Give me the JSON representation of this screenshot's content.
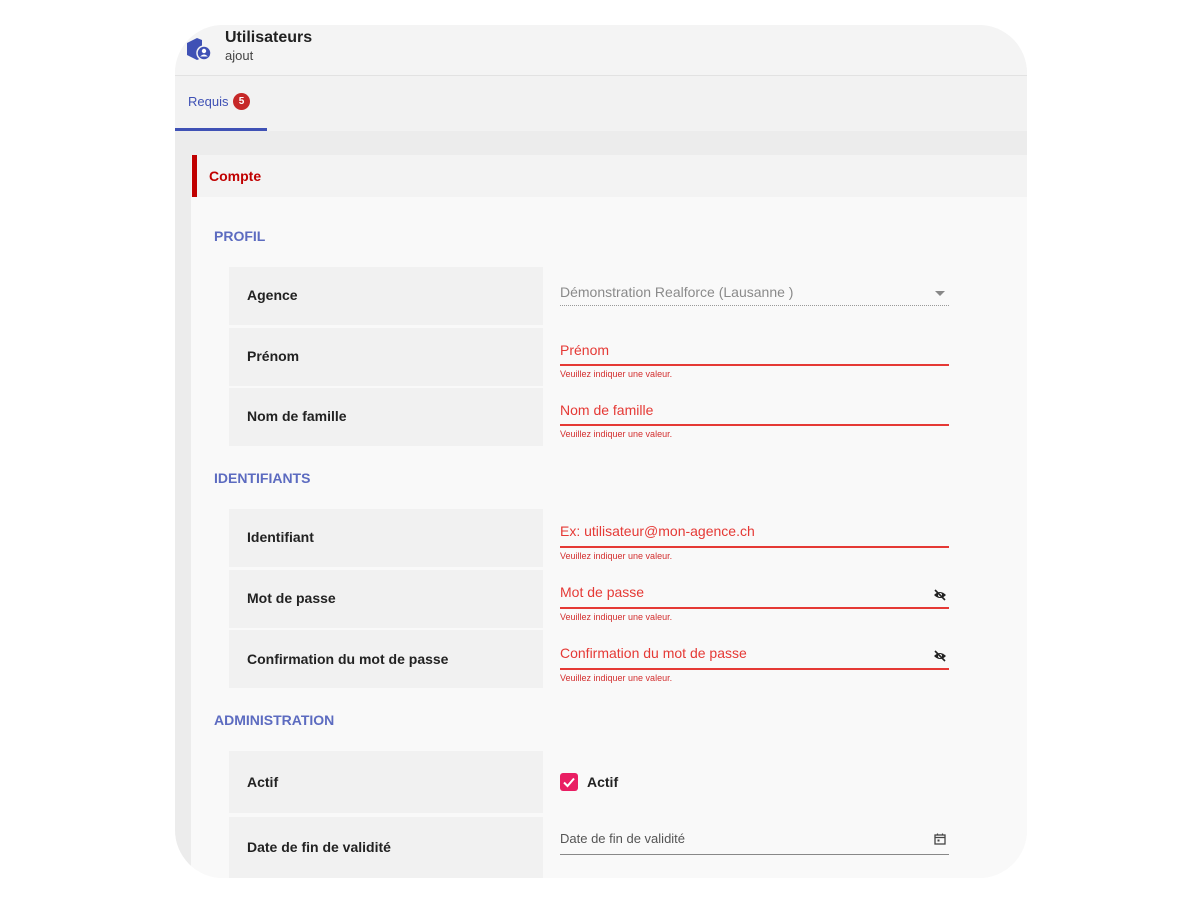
{
  "header": {
    "title": "Utilisateurs",
    "subtitle": "ajout",
    "icon": "user-group-icon"
  },
  "tabs": [
    {
      "label": "Requis",
      "badge": "5",
      "active": true
    }
  ],
  "section": {
    "title": "Compte"
  },
  "groups": {
    "profil": "PROFIL",
    "identifiants": "IDENTIFIANTS",
    "administration": "ADMINISTRATION"
  },
  "fields": {
    "agence": {
      "label": "Agence",
      "value": "Démonstration Realforce (Lausanne )"
    },
    "prenom": {
      "label": "Prénom",
      "placeholder": "Prénom",
      "error": "Veuillez indiquer une valeur."
    },
    "nom": {
      "label": "Nom de famille",
      "placeholder": "Nom de famille",
      "error": "Veuillez indiquer une valeur."
    },
    "identifiant": {
      "label": "Identifiant",
      "placeholder": "Ex: utilisateur@mon-agence.ch",
      "error": "Veuillez indiquer une valeur."
    },
    "password": {
      "label": "Mot de passe",
      "placeholder": "Mot de passe",
      "error": "Veuillez indiquer une valeur."
    },
    "password_confirm": {
      "label": "Confirmation du mot de passe",
      "placeholder": "Confirmation du mot de passe",
      "error": "Veuillez indiquer une valeur."
    },
    "actif": {
      "label": "Actif",
      "checkbox_label": "Actif",
      "checked": true
    },
    "date_fin": {
      "label": "Date de fin de validité",
      "placeholder": "Date de fin de validité"
    }
  },
  "colors": {
    "accent": "#3f51b5",
    "group_title": "#5c6bc0",
    "error": "#d32f2f",
    "section_title": "#c00000",
    "checkbox": "#e91e63"
  }
}
